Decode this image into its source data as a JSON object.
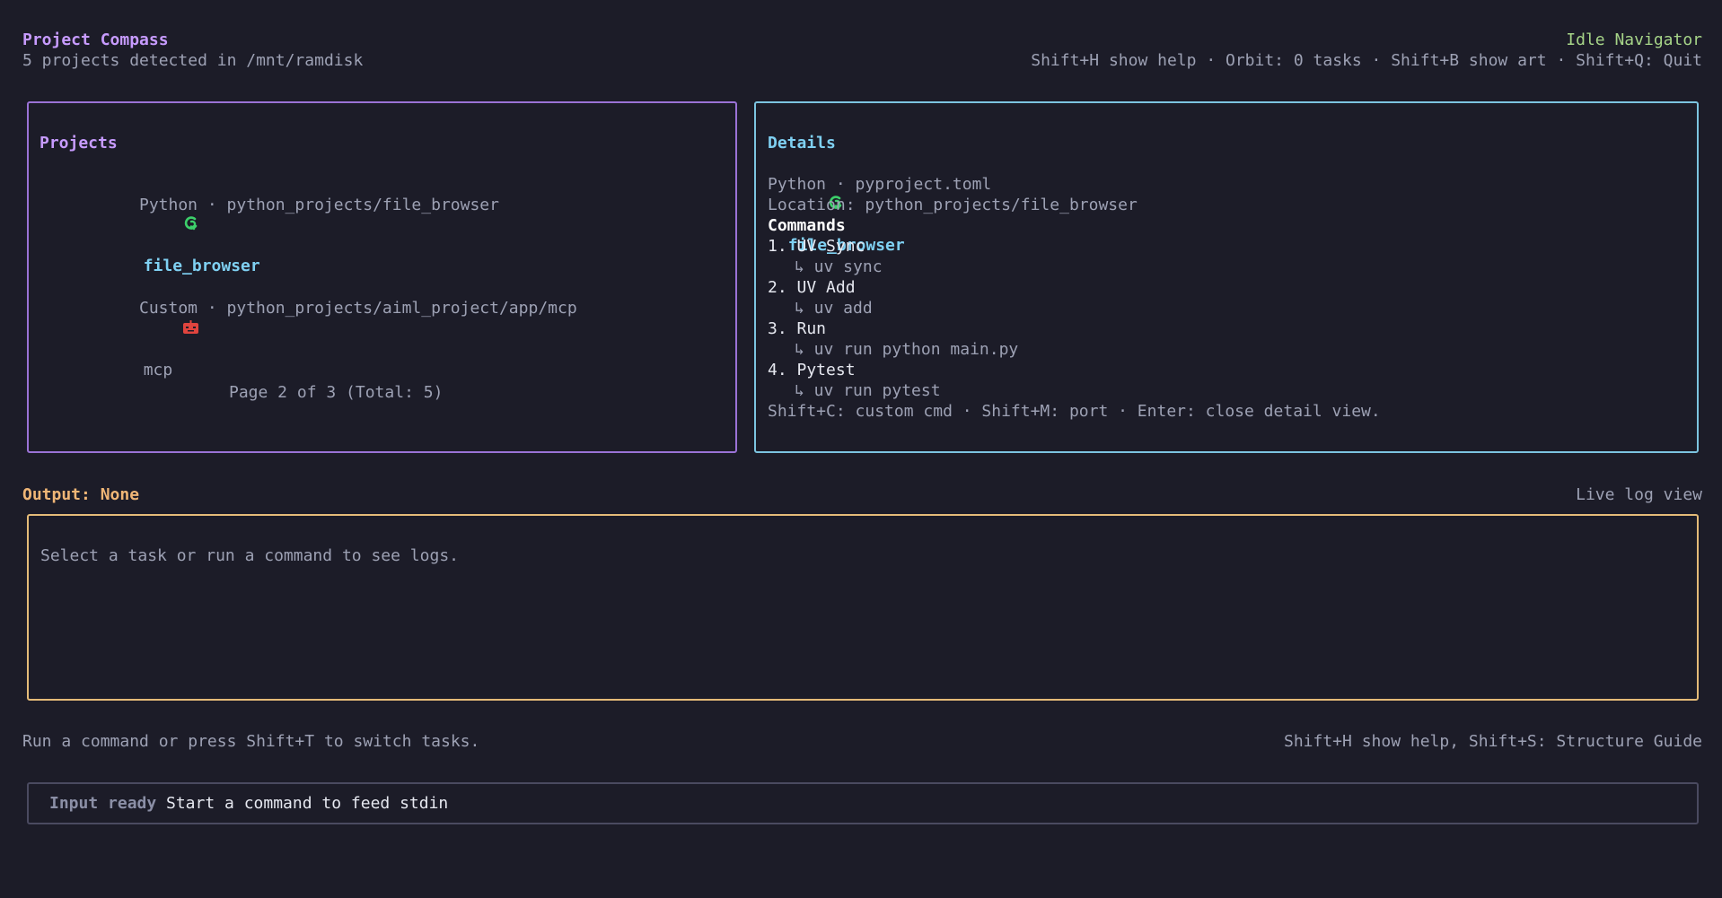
{
  "header": {
    "title": "Project Compass",
    "subtitle": "5 projects detected in /mnt/ramdisk",
    "mode": "Idle Navigator",
    "hints": "Shift+H show help · Orbit: 0 tasks · Shift+B show art · Shift+Q: Quit"
  },
  "projects_panel": {
    "title": "Projects",
    "items": [
      {
        "name": "file_browser",
        "meta": "Python · python_projects/file_browser",
        "icon": "python-uv-icon",
        "selected": true
      },
      {
        "name": "mcp",
        "meta": "Custom · python_projects/aiml_project/app/mcp",
        "icon": "custom-robot-icon",
        "selected": false
      }
    ],
    "pagination": "Page 2 of 3 (Total: 5)"
  },
  "details_panel": {
    "title": "Details",
    "name": "file_browser",
    "meta": "Python · pyproject.toml",
    "location": "Location: python_projects/file_browser",
    "commands_heading": "Commands",
    "commands": [
      {
        "label": "1. UV Sync",
        "cmd": "↳ uv sync"
      },
      {
        "label": "2. UV Add",
        "cmd": "↳ uv add"
      },
      {
        "label": "3. Run",
        "cmd": "↳ uv run python main.py"
      },
      {
        "label": "4. Pytest",
        "cmd": "↳ uv run pytest"
      }
    ],
    "hints": "Shift+C: custom cmd · Shift+M: port · Enter: close detail view."
  },
  "output": {
    "label": "Output: None",
    "mode": "Live log view",
    "empty_message": "Select a task or run a command to see logs."
  },
  "footer": {
    "left": "Run a command or press Shift+T to switch tasks.",
    "right": "Shift+H show help, Shift+S: Structure Guide"
  },
  "input": {
    "status": "Input ready",
    "placeholder": "Start a command to feed stdin"
  },
  "colors": {
    "background": "#1c1c28",
    "accent_purple": "#c79bff",
    "accent_cyan": "#7fd0f2",
    "accent_orange": "#f0b676",
    "accent_green": "#a6d488"
  }
}
